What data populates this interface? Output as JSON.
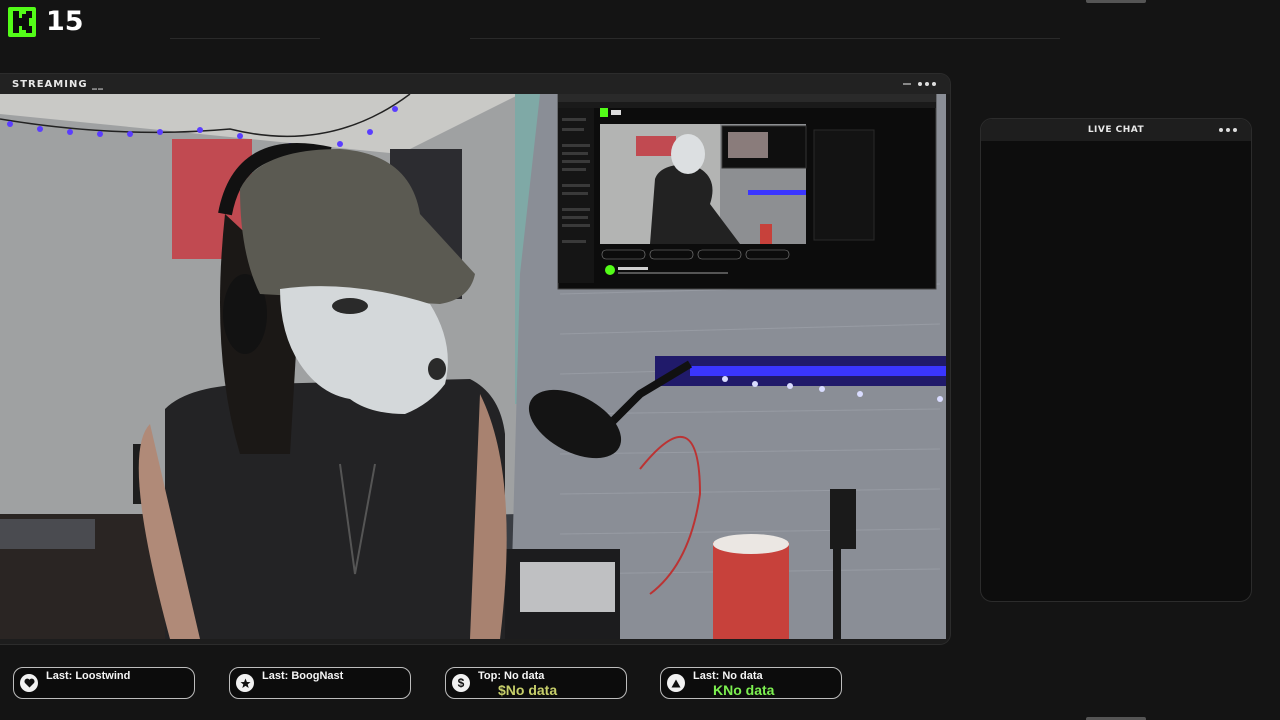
{
  "brand": {
    "logo_number": "15",
    "accent": "#53fc18"
  },
  "stream_panel": {
    "title": "STREAMING __"
  },
  "chat_panel": {
    "title": "LIVE CHAT"
  },
  "alerts": [
    {
      "label": "Last: Loostwind",
      "icon": "heart-icon"
    },
    {
      "label": "Last: BoogNast",
      "icon": "star-icon"
    },
    {
      "label": "Top: No data",
      "value": "$No data",
      "icon": "dollar-icon",
      "value_color": "#c7cf6a"
    },
    {
      "label": "Last: No data",
      "value": "KNo data",
      "icon": "triangle-icon",
      "value_color": "#7cf050"
    }
  ]
}
